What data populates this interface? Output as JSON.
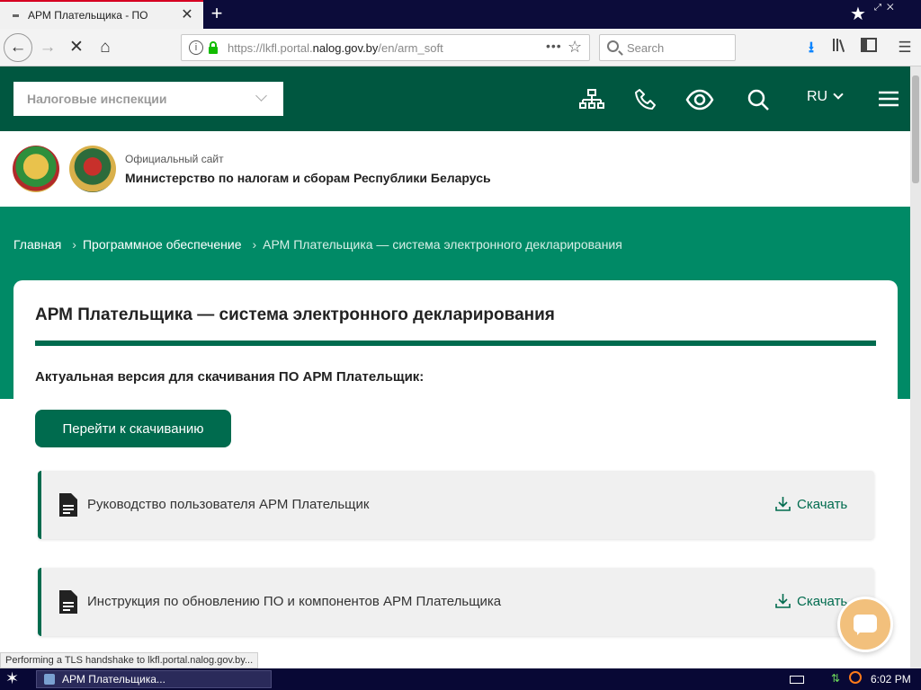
{
  "browser": {
    "tab_title": "АРМ Плательщика - ПО",
    "url_prefix": "https://lkfl.portal.",
    "url_domain": "nalog.gov.by",
    "url_path": "/en/arm_soft",
    "search_placeholder": "Search",
    "status_text": "Performing a TLS handshake to lkfl.portal.nalog.gov.by..."
  },
  "header": {
    "inspection_select_label": "Налоговые инспекции",
    "language": "RU"
  },
  "brand": {
    "small": "Официальный сайт",
    "title": "Министерство по налогам и сборам Республики Беларусь"
  },
  "breadcrumb": {
    "home": "Главная",
    "section": "Программное обеспечение",
    "current": "АРМ Плательщика — система электронного декларирования"
  },
  "main": {
    "title": "АРМ Плательщика — система электронного декларирования",
    "version_label": "Актуальная версия для скачивания ПО АРМ Плательщик:",
    "download_button": "Перейти к скачиванию",
    "documents": [
      {
        "label": "Руководство пользователя АРМ Плательщик",
        "action": "Скачать"
      },
      {
        "label": "Инструкция по обновлению ПО и компонентов АРМ Плательщика",
        "action": "Скачать"
      }
    ]
  },
  "taskbar": {
    "task_title": "АРМ Плательщика...",
    "clock": "6:02 PM"
  },
  "colors": {
    "header_green": "#005740",
    "band_green": "#008a66",
    "accent_green": "#006b4e",
    "chat_orange": "#f2c07c"
  }
}
